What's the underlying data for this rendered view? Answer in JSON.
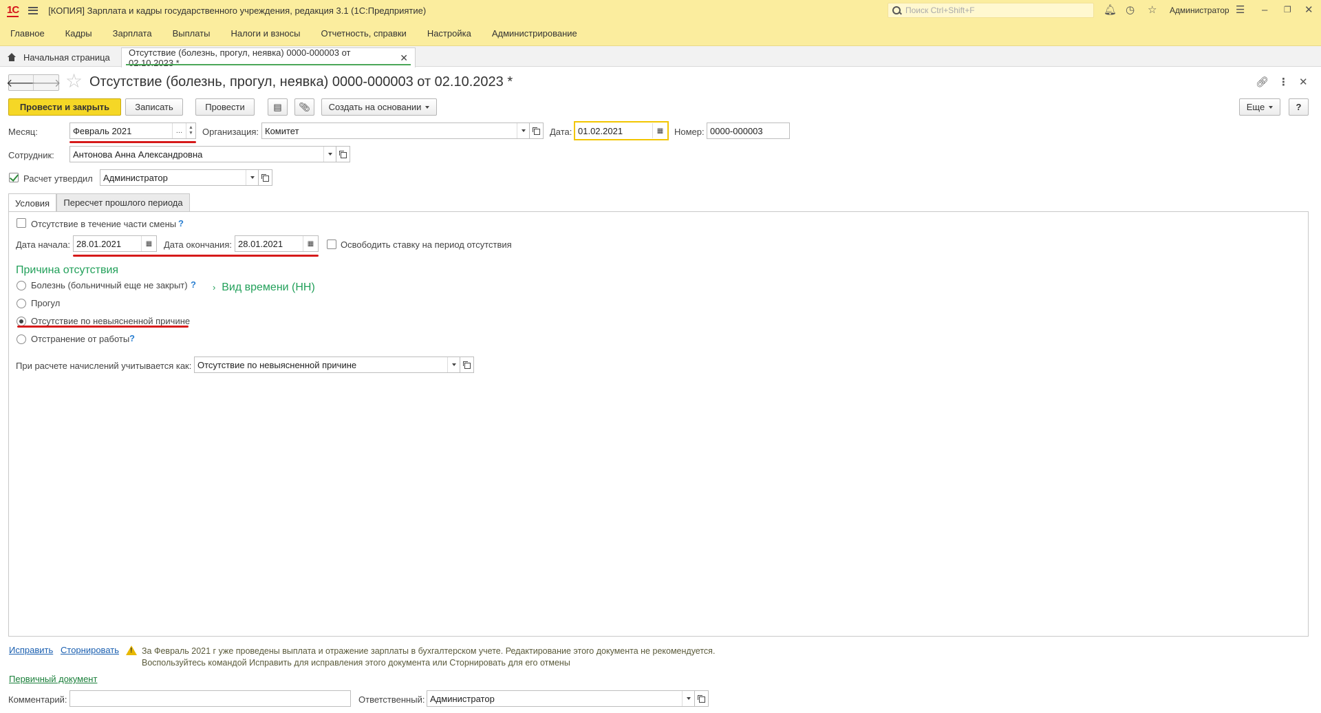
{
  "titlebar": {
    "logo": "1С",
    "app_title": "[КОПИЯ] Зарплата и кадры государственного учреждения, редакция 3.1  (1С:Предприятие)",
    "search_placeholder": "Поиск Ctrl+Shift+F",
    "user": "Администратор"
  },
  "menu": [
    "Главное",
    "Кадры",
    "Зарплата",
    "Выплаты",
    "Налоги и взносы",
    "Отчетность, справки",
    "Настройка",
    "Администрирование"
  ],
  "tabs": {
    "home": "Начальная страница",
    "doc": "Отсутствие (болезнь, прогул, неявка) 0000-000003 от 02.10.2023 *"
  },
  "form": {
    "title": "Отсутствие (болезнь, прогул, неявка) 0000-000003 от 02.10.2023 *",
    "buttons": {
      "post_close": "Провести и закрыть",
      "write": "Записать",
      "post": "Провести",
      "create_based": "Создать на основании",
      "more": "Еще",
      "help": "?"
    },
    "month_label": "Месяц:",
    "month_value": "Февраль 2021",
    "org_label": "Организация:",
    "org_value": "Комитет",
    "date_label": "Дата:",
    "date_value": "01.02.2021",
    "number_label": "Номер:",
    "number_value": "0000-000003",
    "employee_label": "Сотрудник:",
    "employee_value": "Антонова Анна Александровна",
    "approved_label": "Расчет утвердил",
    "approved_checked": true,
    "approved_value": "Администратор",
    "form_tabs": [
      "Условия",
      "Пересчет прошлого периода"
    ],
    "partial_shift_label": "Отсутствие в течение части смены",
    "partial_shift_checked": false,
    "start_label": "Дата начала:",
    "start_value": "28.01.2021",
    "end_label": "Дата окончания:",
    "end_value": "28.01.2021",
    "free_rate_label": "Освободить ставку на период отсутствия",
    "free_rate_checked": false,
    "reason_title": "Причина отсутствия",
    "reasons": [
      {
        "label": "Болезнь (больничный еще не закрыт)",
        "selected": false,
        "help": true
      },
      {
        "label": "Прогул",
        "selected": false,
        "help": false
      },
      {
        "label": "Отсутствие по невыясненной причине",
        "selected": true,
        "help": false
      },
      {
        "label": "Отстранение от работы",
        "selected": false,
        "help": true
      }
    ],
    "time_kind_link": "Вид времени (НН)",
    "calc_label": "При расчете начислений учитывается как:",
    "calc_value": "Отсутствие по невыясненной причине"
  },
  "footer": {
    "fix_link": "Исправить",
    "storno_link": "Сторнировать",
    "warning_line1": "За Февраль 2021 г уже проведены выплата и отражение зарплаты в бухгалтерском учете. Редактирование этого документа не рекомендуется.",
    "warning_line2": "Воспользуйтесь командой Исправить для исправления этого документа или Сторнировать для его отмены",
    "primary_doc_link": "Первичный документ",
    "comment_label": "Комментарий:",
    "comment_value": "",
    "responsible_label": "Ответственный:",
    "responsible_value": "Администратор"
  },
  "colors": {
    "titlebar_bg": "#fbed9e",
    "primary_button": "#f5d726",
    "accent_green": "#22a05a",
    "annotation_red": "#d61a1a"
  }
}
